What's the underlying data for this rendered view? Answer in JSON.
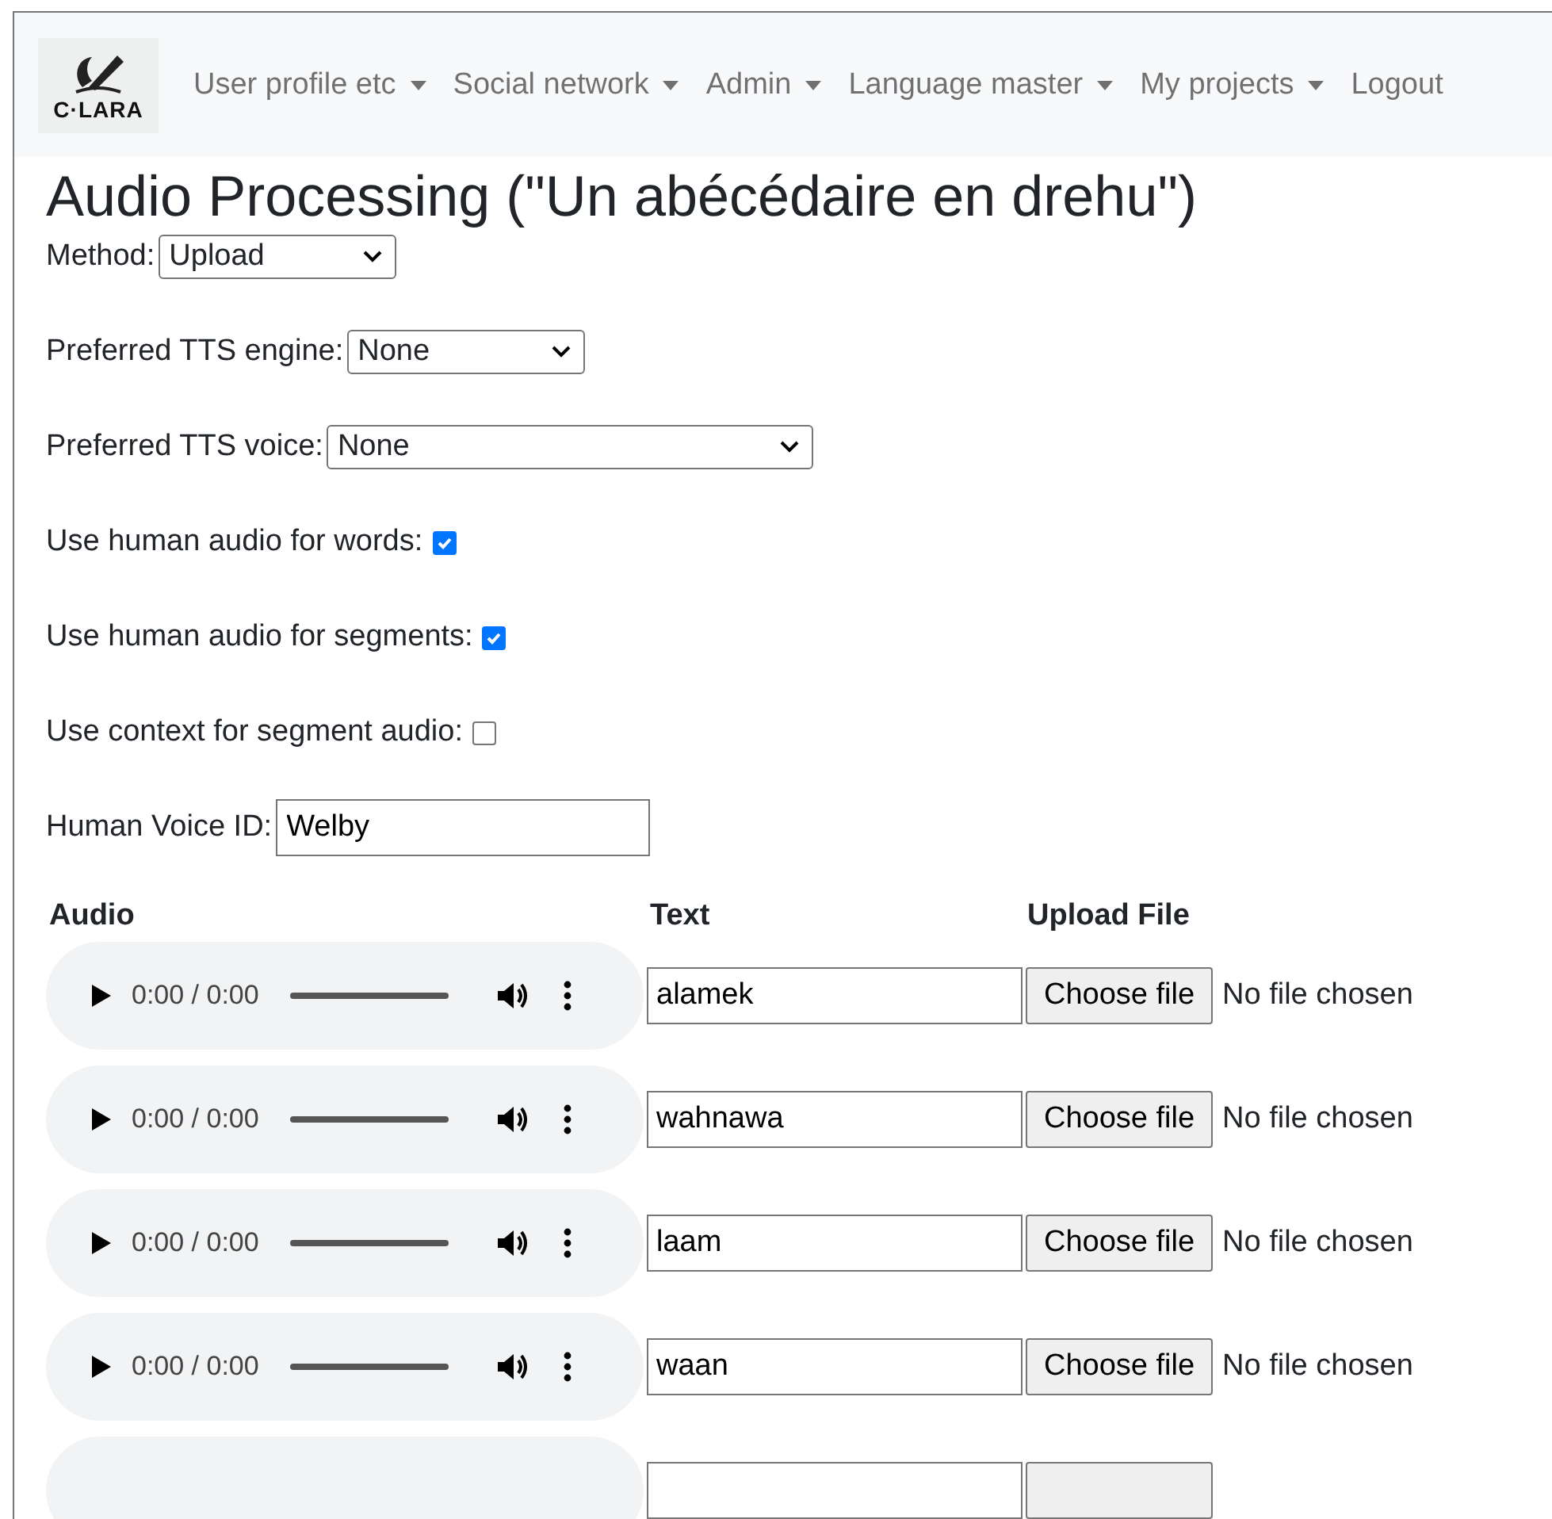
{
  "navbar": {
    "logo_text": "C·LARA",
    "items": [
      {
        "label": "User profile etc",
        "dropdown": true
      },
      {
        "label": "Social network",
        "dropdown": true
      },
      {
        "label": "Admin",
        "dropdown": true
      },
      {
        "label": "Language master",
        "dropdown": true
      },
      {
        "label": "My projects",
        "dropdown": true
      },
      {
        "label": "Logout",
        "dropdown": false
      }
    ]
  },
  "title": "Audio Processing (\"Un abécédaire en drehu\")",
  "settings": [
    {
      "kind": "select",
      "label": "Method:",
      "value": "Upload"
    },
    {
      "kind": "select",
      "label": "Preferred TTS engine:",
      "value": "None"
    },
    {
      "kind": "wide_select",
      "label": "Preferred TTS voice:",
      "value": "None"
    },
    {
      "kind": "checkbox",
      "label": "Use human audio for words:",
      "checked": true
    },
    {
      "kind": "checkbox",
      "label": "Use human audio for segments:",
      "checked": true
    },
    {
      "kind": "checkbox",
      "label": "Use context for segment audio:",
      "checked": false
    },
    {
      "kind": "text",
      "label": "Human Voice ID:",
      "value": "Welby"
    }
  ],
  "table": {
    "columns": [
      "Audio",
      "Text",
      "Upload File"
    ],
    "rows": [
      {
        "time": "0:00 / 0:00",
        "text": "alamek",
        "button": "Choose file",
        "file_status": "No file chosen"
      },
      {
        "time": "0:00 / 0:00",
        "text": "wahnawa",
        "button": "Choose file",
        "file_status": "No file chosen"
      },
      {
        "time": "0:00 / 0:00",
        "text": "laam",
        "button": "Choose file",
        "file_status": "No file chosen"
      },
      {
        "time": "0:00 / 0:00",
        "text": "waan",
        "button": "Choose file",
        "file_status": "No file chosen"
      },
      {
        "cut_off": true
      }
    ]
  }
}
